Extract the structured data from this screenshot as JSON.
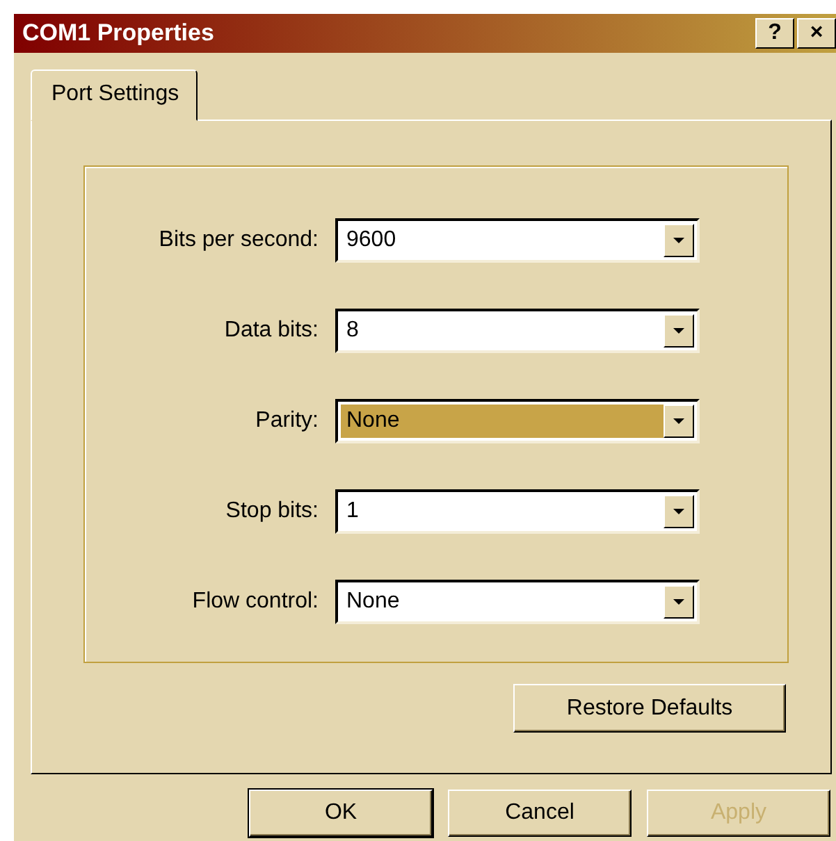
{
  "window": {
    "title": "COM1 Properties",
    "help_button": "?",
    "close_button": "×"
  },
  "tabs": [
    {
      "label": "Port Settings",
      "selected": true
    }
  ],
  "fields": [
    {
      "label": "Bits per second:",
      "value": "9600",
      "selected": false
    },
    {
      "label": "Data bits:",
      "value": "8",
      "selected": false
    },
    {
      "label": "Parity:",
      "value": "None",
      "selected": true
    },
    {
      "label": "Stop bits:",
      "value": "1",
      "selected": false
    },
    {
      "label": "Flow control:",
      "value": "None",
      "selected": false
    }
  ],
  "restore_button": "Restore Defaults",
  "buttons": [
    {
      "label": "OK",
      "default": true,
      "disabled": false
    },
    {
      "label": "Cancel",
      "default": false,
      "disabled": false
    },
    {
      "label": "Apply",
      "default": false,
      "disabled": true
    }
  ]
}
